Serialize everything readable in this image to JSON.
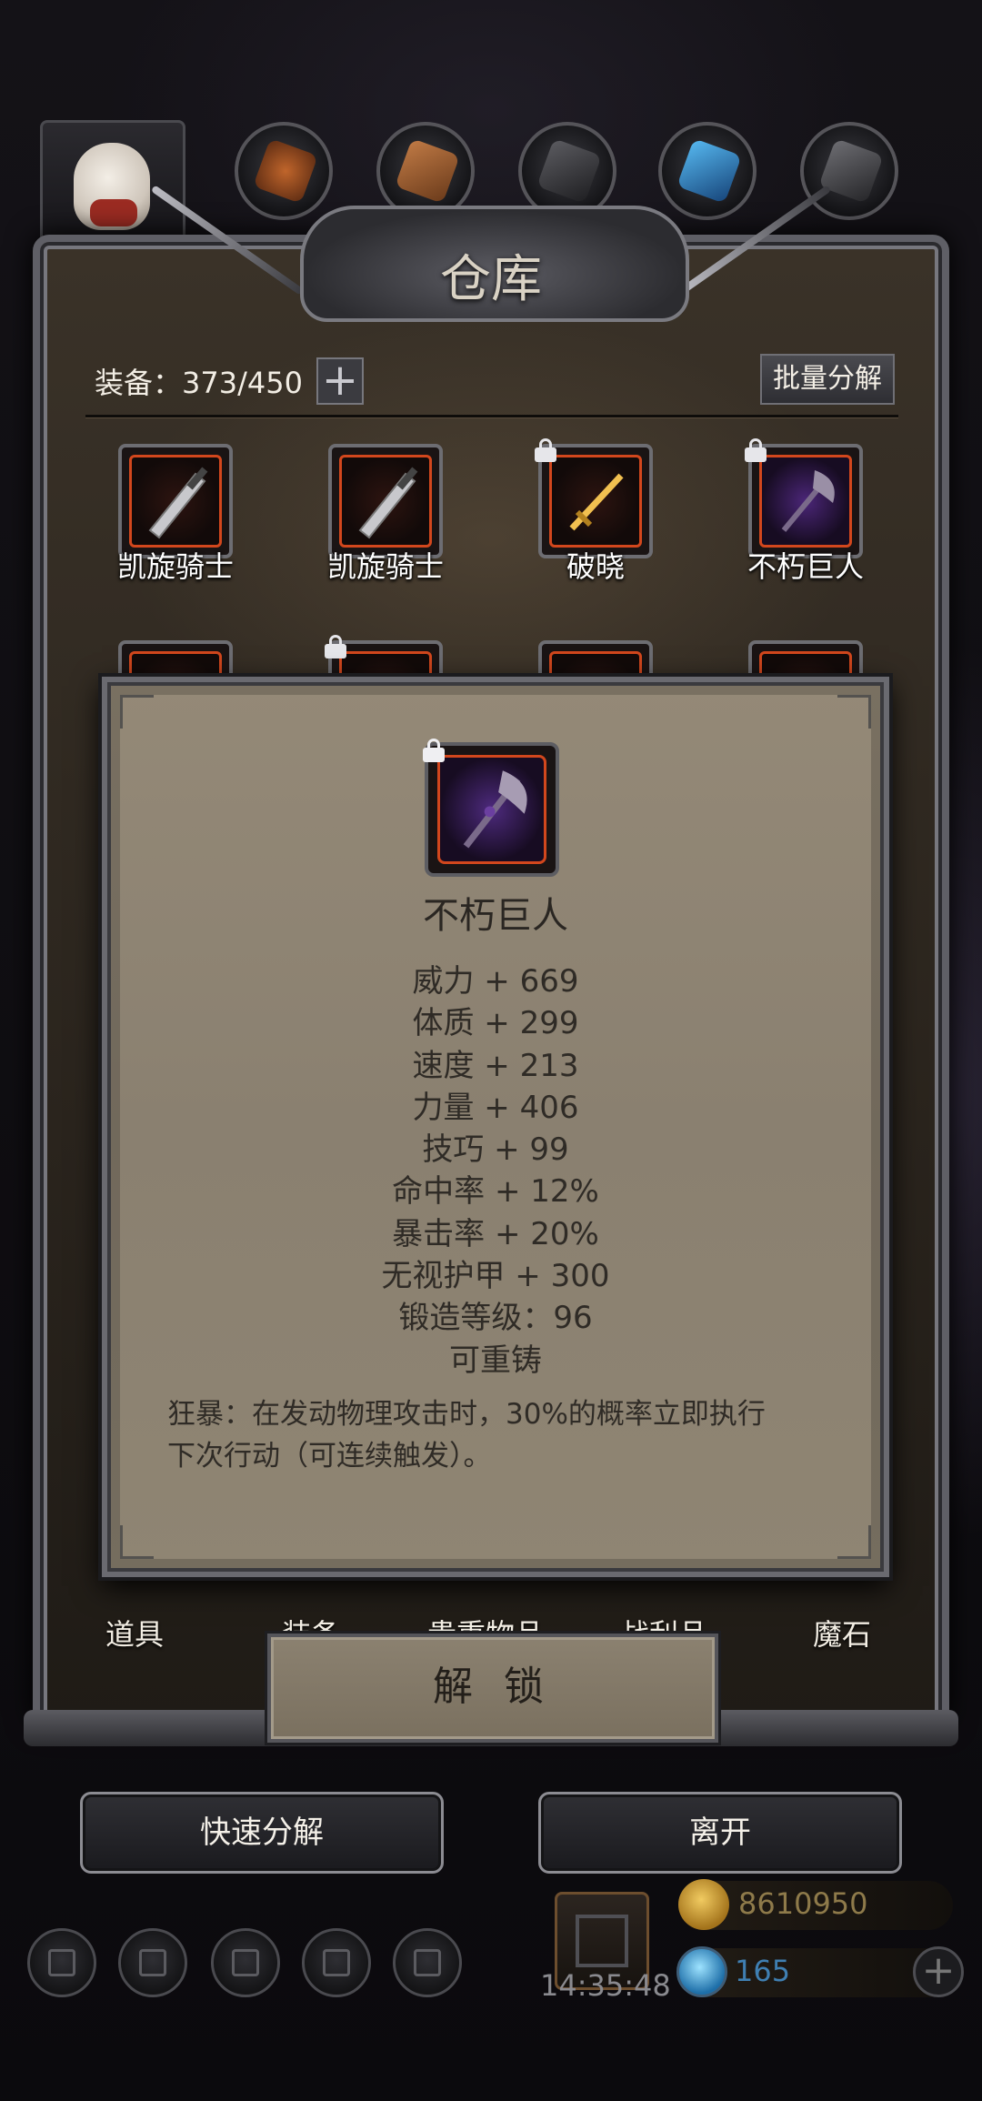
{
  "header": {
    "title": "仓库",
    "material_orbs": [
      "copper-ore",
      "wood-plank",
      "iron-ingot",
      "crystal",
      "steel-ingot"
    ]
  },
  "inventory": {
    "capacity_label": "装备：373/450",
    "expand_symbol": "+",
    "batch_button": "批量分解",
    "row1": [
      {
        "name": "凯旋骑士",
        "icon": "greatsword-icon",
        "locked": false
      },
      {
        "name": "凯旋骑士",
        "icon": "greatsword-icon",
        "locked": false
      },
      {
        "name": "破晓",
        "icon": "golden-sword-icon",
        "locked": true
      },
      {
        "name": "不朽巨人",
        "icon": "purple-axe-icon",
        "locked": true
      }
    ]
  },
  "tooltip": {
    "item_name": "不朽巨人",
    "stats": [
      "威力 + 669",
      "体质 + 299",
      "速度 + 213",
      "力量 + 406",
      "技巧 + 99",
      "命中率 + 12%",
      "暴击率 + 20%",
      "无视护甲 + 300",
      "锻造等级：96",
      "可重铸"
    ],
    "description_line1": "狂暴：在发动物理攻击时，30%的概率立即执行",
    "description_line2": "下次行动（可连续触发）。"
  },
  "tabs": {
    "items": "道具",
    "equipment": "装备",
    "valuables": "贵重物品",
    "loot": "战利品",
    "magic_stone": "魔石"
  },
  "unlock_button": "解 锁",
  "buttons": {
    "quick_decompose": "快速分解",
    "leave": "离开"
  },
  "hud": {
    "timer": "14:35:48",
    "gold": "8610950",
    "gems": "165",
    "add_symbol": "+"
  },
  "colors": {
    "rarity_border": "#d2471d",
    "parchment": "#8a8070",
    "panel": "#2a241d"
  }
}
